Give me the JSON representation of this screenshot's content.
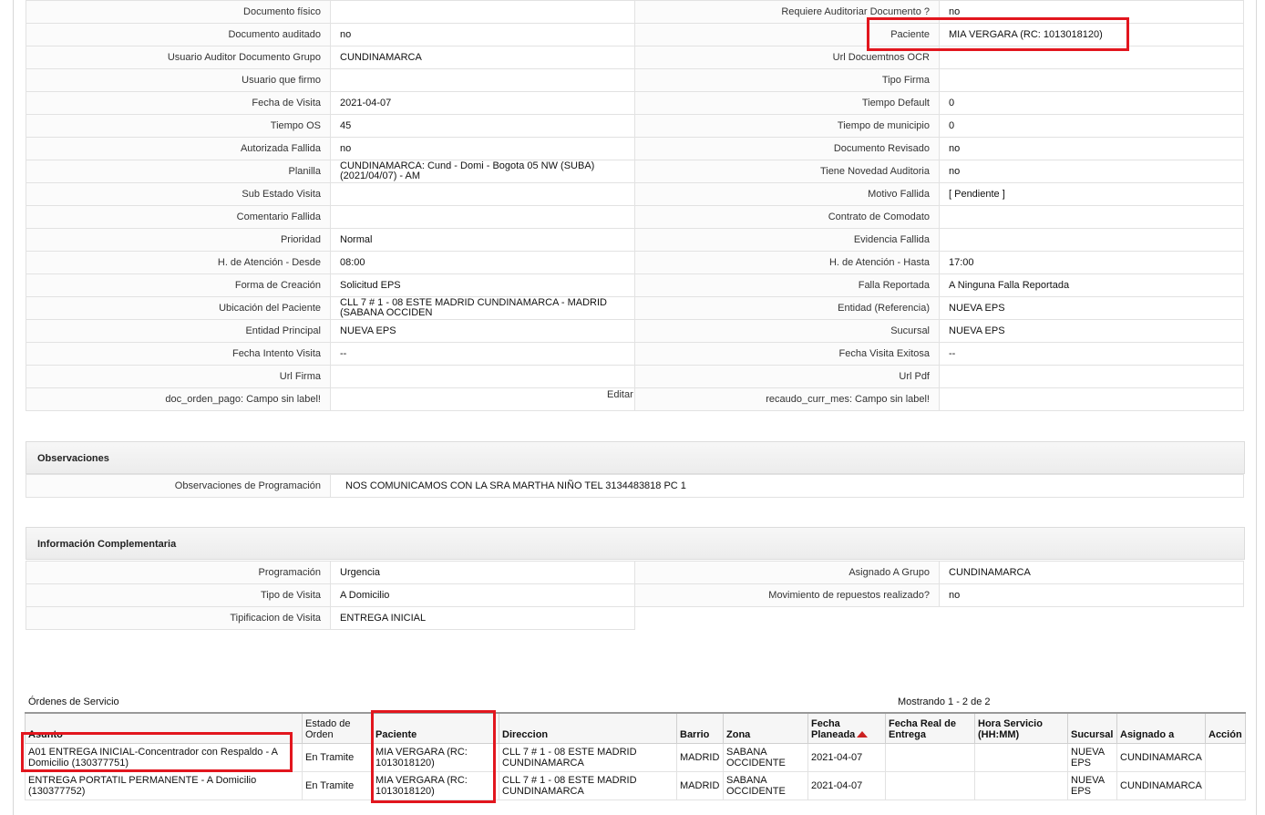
{
  "details": {
    "rows": [
      {
        "l1": "Documento físico",
        "v1": "",
        "l2": "Requiere Auditoriar Documento ?",
        "v2": "no"
      },
      {
        "l1": "Documento auditado",
        "v1": "no",
        "l2": "Paciente",
        "v2": "MIA VERGARA (RC: 1013018120)"
      },
      {
        "l1": "Usuario Auditor Documento Grupo",
        "v1": "CUNDINAMARCA",
        "l2": "Url Docuemtnos OCR",
        "v2": ""
      },
      {
        "l1": "Usuario que firmo",
        "v1": "",
        "l2": "Tipo Firma",
        "v2": ""
      },
      {
        "l1": "Fecha de Visita",
        "v1": "2021-04-07",
        "l2": "Tiempo Default",
        "v2": "0"
      },
      {
        "l1": "Tiempo OS",
        "v1": "45",
        "l2": "Tiempo de municipio",
        "v2": "0"
      },
      {
        "l1": "Autorizada Fallida",
        "v1": "no",
        "l2": "Documento Revisado",
        "v2": "no"
      },
      {
        "l1": "Planilla",
        "v1": "CUNDINAMARCA: Cund - Domi - Bogota 05 NW (SUBA) (2021/04/07) - AM",
        "l2": "Tiene Novedad Auditoria",
        "v2": "no"
      },
      {
        "l1": "Sub Estado Visita",
        "v1": "",
        "l2": "Motivo Fallida",
        "v2": "[ Pendiente ]"
      },
      {
        "l1": "Comentario Fallida",
        "v1": "",
        "l2": "Contrato de Comodato",
        "v2": ""
      },
      {
        "l1": "Prioridad",
        "v1": "Normal",
        "l2": "Evidencia Fallida",
        "v2": ""
      },
      {
        "l1": "H. de Atención - Desde",
        "v1": "08:00",
        "l2": "H. de Atención - Hasta",
        "v2": "17:00"
      },
      {
        "l1": "Forma de Creación",
        "v1": "Solicitud EPS",
        "l2": "Falla Reportada",
        "v2": "A Ninguna Falla Reportada"
      },
      {
        "l1": "Ubicación del Paciente",
        "v1": "CLL 7 # 1 - 08 ESTE MADRID CUNDINAMARCA - MADRID (SABANA OCCIDEN",
        "l2": "Entidad (Referencia)",
        "v2": "NUEVA EPS"
      },
      {
        "l1": "Entidad Principal",
        "v1": "NUEVA EPS",
        "l2": "Sucursal",
        "v2": "NUEVA EPS"
      },
      {
        "l1": "Fecha Intento Visita",
        "v1": "--",
        "l2": "Fecha Visita Exitosa",
        "v2": "--"
      },
      {
        "l1": "Url Firma",
        "v1": "",
        "l2": "Url Pdf",
        "v2": ""
      },
      {
        "l1": "doc_orden_pago: Campo sin label!",
        "v1": "",
        "l2": "recaudo_curr_mes: Campo sin label!",
        "v2": ""
      }
    ],
    "edit_label": "Editar"
  },
  "observaciones": {
    "title": "Observaciones",
    "label": "Observaciones de Programación",
    "value": "NOS COMUNICAMOS CON LA SRA MARTHA NIÑO TEL 3134483818 PC 1"
  },
  "complementaria": {
    "title": "Información Complementaria",
    "rows": [
      {
        "l1": "Programación",
        "v1": "Urgencia",
        "l2": "Asignado A Grupo",
        "v2": "CUNDINAMARCA"
      },
      {
        "l1": "Tipo de Visita",
        "v1": "A Domicilio",
        "l2": "Movimiento de repuestos realizado?",
        "v2": "no"
      },
      {
        "l1": "Tipificacion de Visita",
        "v1": "ENTREGA INICIAL"
      }
    ]
  },
  "ordenes": {
    "title": "Órdenes de Servicio",
    "count": "Mostrando 1 - 2 de 2",
    "headers": [
      "Asunto",
      "Estado de Orden",
      "Paciente",
      "Direccion",
      "Barrio",
      "Zona",
      "Fecha Planeada",
      "Fecha Real de Entrega",
      "Hora Servicio (HH:MM)",
      "Sucursal",
      "Asignado a",
      "Acción"
    ],
    "rows": [
      [
        "A01 ENTREGA INICIAL-Concentrador con Respaldo - A Domicilio (130377751)",
        "En Tramite",
        "MIA VERGARA (RC: 1013018120)",
        "CLL 7 # 1 - 08 ESTE MADRID CUNDINAMARCA",
        "MADRID",
        "SABANA OCCIDENTE",
        "2021-04-07",
        "",
        "",
        "NUEVA EPS",
        "CUNDINAMARCA",
        ""
      ],
      [
        "ENTREGA PORTATIL PERMANENTE - A Domicilio (130377752)",
        "En Tramite",
        "MIA VERGARA (RC: 1013018120)",
        "CLL 7 # 1 - 08 ESTE MADRID CUNDINAMARCA",
        "MADRID",
        "SABANA OCCIDENTE",
        "2021-04-07",
        "",
        "",
        "NUEVA EPS",
        "CUNDINAMARCA",
        ""
      ]
    ]
  },
  "highlight_color": "#e2161e"
}
